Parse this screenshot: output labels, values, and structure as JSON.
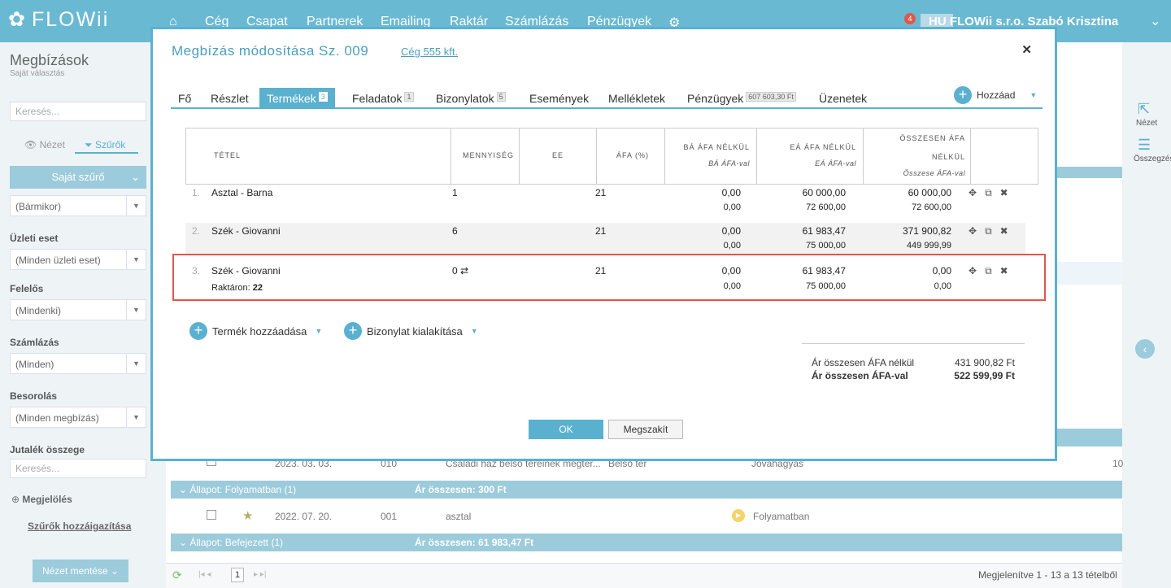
{
  "topbar": {
    "logo": "FLOWii",
    "nav": [
      "Cég",
      "Csapat",
      "Partnerek",
      "Emailing",
      "Raktár",
      "Számlázás",
      "Pénzügyek"
    ],
    "notif_count": "4",
    "user": "HU FLOWii s.r.o.  Szabó Krisztina"
  },
  "sidebar": {
    "title": "Megbízások",
    "subtitle": "Saját választás",
    "search_placeholder": "Keresés...",
    "view_tab": "Nézet",
    "filter_tab": "Szűrők",
    "own_filter": "Saját szűrő",
    "date_select": "(Bármikor)",
    "business_label": "Üzleti eset",
    "business_select": "(Minden üzleti eset)",
    "owner_label": "Felelős",
    "owner_select": "(Mindenki)",
    "billing_label": "Számlázás",
    "billing_select": "(Minden)",
    "class_label": "Besorolás",
    "class_select": "(Minden megbízás)",
    "commission_label": "Jutalék összege",
    "commission_placeholder": "Keresés...",
    "marking": "Megjelölés",
    "assign_filters": "Szűrők hozzáigazítása",
    "save_view": "Nézet mentése"
  },
  "rightbar": {
    "view": "Nézet",
    "summary": "Összegzés"
  },
  "list": {
    "row1": {
      "date": "2023. 03. 03.",
      "num": "010",
      "name": "Családi ház belső tereinek megter...",
      "type": "Belső tér",
      "status": "Jóváhagyás",
      "value": "10"
    },
    "group1": {
      "label": "Állapot: Folyamatban (1)",
      "total": "Ár összesen: 300 Ft"
    },
    "row2": {
      "date": "2022. 07. 20.",
      "num": "001",
      "name": "asztal",
      "status": "Folyamatban"
    },
    "group2": {
      "label": "Állapot: Befejezett (1)",
      "total": "Ár összesen: 61 983,47 Ft"
    },
    "pager": {
      "page": "1",
      "info": "Megjelenítve 1 - 13 a 13 tételből"
    }
  },
  "modal": {
    "title": "Megbízás módosítása Sz. 009",
    "company_link": "Cég 555 kft.",
    "tabs": [
      {
        "label": "Fő",
        "badge": ""
      },
      {
        "label": "Részlet",
        "badge": ""
      },
      {
        "label": "Termékek",
        "badge": "3"
      },
      {
        "label": "Feladatok",
        "badge": "1"
      },
      {
        "label": "Bizonylatok",
        "badge": "5"
      },
      {
        "label": "Események",
        "badge": ""
      },
      {
        "label": "Mellékletek",
        "badge": ""
      },
      {
        "label": "Pénzügyek",
        "badge": "607 603,30 Ft"
      },
      {
        "label": "Üzenetek",
        "badge": ""
      }
    ],
    "add_label": "Hozzáad",
    "headers": {
      "item": "TÉTEL",
      "qty": "MENNYISÉG",
      "unit": "EE",
      "vat": "ÁFA (%)",
      "buy": "BÁ ÁFA NÉLKÜL",
      "buy_sub": "BÁ ÁFA-val",
      "sell": "EÁ ÁFA NÉLKÜL",
      "sell_sub": "EÁ ÁFA-val",
      "total1": "ÖSSZESEN ÁFA",
      "total2": "NÉLKÜL",
      "total_sub": "Összese ÁFA-val"
    },
    "rows": [
      {
        "n": "1.",
        "name": "Asztal - Barna",
        "qty": "1",
        "vat": "21",
        "buy": "0,00",
        "buy2": "0,00",
        "sell": "60 000,00",
        "sell2": "72 600,00",
        "total": "60 000,00",
        "total2": "72 600,00",
        "stock": ""
      },
      {
        "n": "2.",
        "name": "Szék - Giovanni",
        "qty": "6",
        "vat": "21",
        "buy": "0,00",
        "buy2": "0,00",
        "sell": "61 983,47",
        "sell2": "75 000,00",
        "total": "371 900,82",
        "total2": "449 999,99",
        "stock": ""
      },
      {
        "n": "3.",
        "name": "Szék - Giovanni",
        "qty": "0",
        "vat": "21",
        "buy": "0,00",
        "buy2": "0,00",
        "sell": "61 983,47",
        "sell2": "75 000,00",
        "total": "0,00",
        "total2": "0,00",
        "stock_label": "Raktáron:",
        "stock": "22"
      }
    ],
    "add_product": "Termék hozzáadása",
    "create_doc": "Bizonylat kialakítása",
    "totals": {
      "net_label": "Ár összesen ÁFA nélkül",
      "net": "431 900,82 Ft",
      "gross_label": "Ár összesen ÁFA-val",
      "gross": "522 599,99 Ft"
    },
    "ok": "OK",
    "cancel": "Megszakít"
  }
}
